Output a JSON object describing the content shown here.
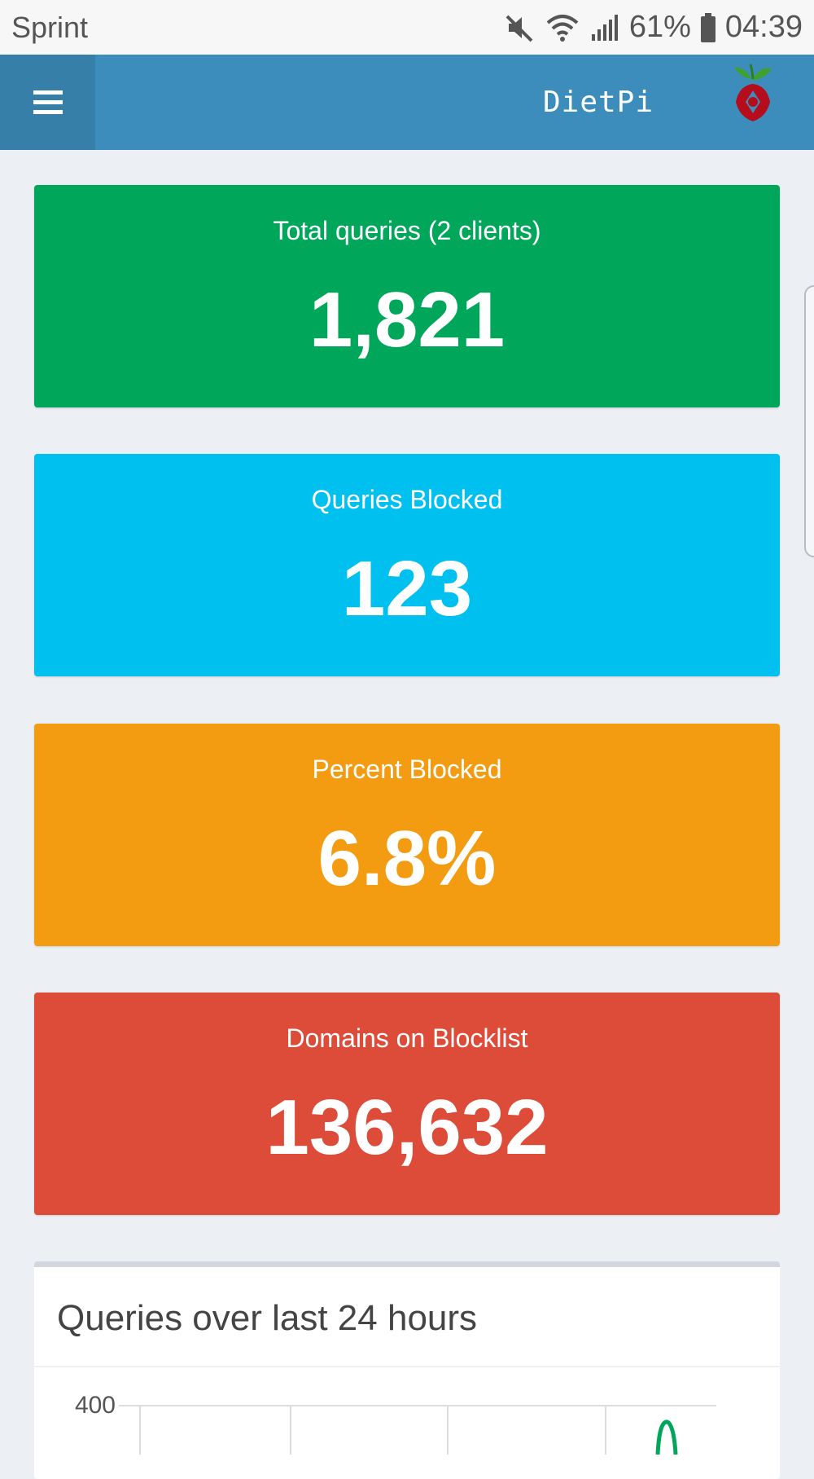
{
  "status_bar": {
    "carrier": "Sprint",
    "battery": "61%",
    "time": "04:39",
    "icons": [
      "mute-icon",
      "wifi-icon",
      "signal-icon",
      "battery-icon"
    ]
  },
  "header": {
    "brand": "DietPi",
    "menu_icon": "hamburger-icon",
    "logo": "pihole-logo"
  },
  "stats": [
    {
      "label": "Total queries (2 clients)",
      "value": "1,821",
      "color": "#00a65a"
    },
    {
      "label": "Queries Blocked",
      "value": "123",
      "color": "#00c0ef"
    },
    {
      "label": "Percent Blocked",
      "value": "6.8%",
      "color": "#f39c12"
    },
    {
      "label": "Domains on Blocklist",
      "value": "136,632",
      "color": "#dd4b39"
    }
  ],
  "chart": {
    "title": "Queries over last 24 hours"
  },
  "chart_data": {
    "type": "line",
    "title": "Queries over last 24 hours",
    "y_tick_labels": [
      "400"
    ],
    "series": [
      {
        "color": "#00a65a"
      }
    ]
  }
}
